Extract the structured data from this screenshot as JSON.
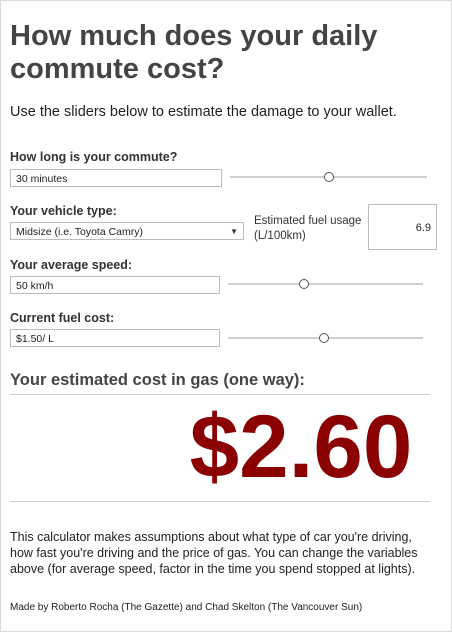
{
  "header": {
    "title": "How much does your daily commute cost?",
    "subtitle": "Use the sliders below to estimate the damage to your wallet."
  },
  "commute": {
    "label": "How long is your commute?",
    "value": "30 minutes",
    "slider_level": 0.5
  },
  "vehicle": {
    "label": "Your vehicle type:",
    "selected": "Midsize (i.e. Toyota Camry)",
    "fuel_label": "Estimated fuel usage (L/100km)",
    "fuel_value": "6.9"
  },
  "speed": {
    "label": "Your average speed:",
    "value": "50 km/h",
    "slider_level": 0.39
  },
  "fuel_cost": {
    "label": "Current fuel cost:",
    "value": "$1.50/ L",
    "slider_level": 0.49
  },
  "result": {
    "heading": "Your estimated cost in gas (one way):",
    "value": "$2.60",
    "value_color": "#8b0000"
  },
  "footer": {
    "disclaimer": "This calculator makes assumptions about what type of car you're driving, how fast you're driving and the price of gas. You can change the variables above (for average speed, factor in the time you spend stopped at lights).",
    "credit": "Made by Roberto Rocha (The Gazette) and Chad Skelton (The Vancouver Sun)"
  }
}
